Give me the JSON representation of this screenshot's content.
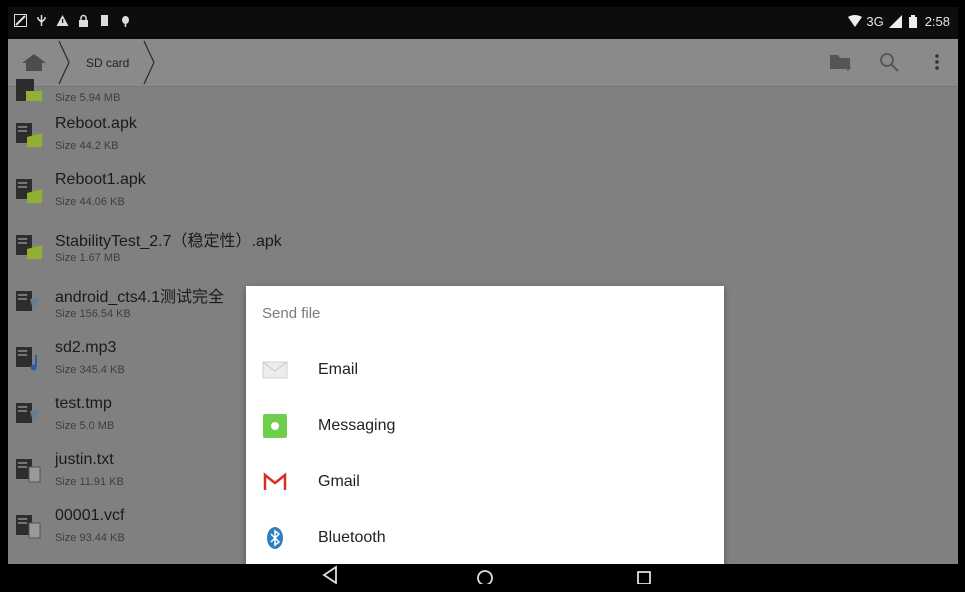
{
  "status_bar": {
    "network": "3G",
    "time": "2:58"
  },
  "action_bar": {
    "breadcrumb": "SD card",
    "icons": [
      "home-icon",
      "new-folder-icon",
      "search-icon",
      "overflow-menu-icon"
    ]
  },
  "files": [
    {
      "name": "",
      "size": "Size 5.94 MB",
      "type": "apk"
    },
    {
      "name": "Reboot.apk",
      "size": "Size 44.2 KB",
      "type": "apk"
    },
    {
      "name": "Reboot1.apk",
      "size": "Size 44.06 KB",
      "type": "apk"
    },
    {
      "name": "StabilityTest_2.7（稳定性）.apk",
      "size": "Size 1.67 MB",
      "type": "apk"
    },
    {
      "name": "android_cts4.1测试完全",
      "size": "Size 156.54 KB",
      "type": "generic"
    },
    {
      "name": "sd2.mp3",
      "size": "Size 345.4 KB",
      "type": "audio"
    },
    {
      "name": "test.tmp",
      "size": "Size 5.0 MB",
      "type": "generic"
    },
    {
      "name": "justin.txt",
      "size": "Size 11.91 KB",
      "type": "text"
    },
    {
      "name": "00001.vcf",
      "size": "Size 93.44 KB",
      "type": "text"
    }
  ],
  "dialog": {
    "title": "Send file",
    "options": [
      {
        "label": "Email",
        "icon": "email-icon"
      },
      {
        "label": "Messaging",
        "icon": "messaging-icon"
      },
      {
        "label": "Gmail",
        "icon": "gmail-icon"
      },
      {
        "label": "Bluetooth",
        "icon": "bluetooth-icon"
      }
    ]
  },
  "nav_bar": {
    "icons": [
      "back-icon",
      "home-circle-icon",
      "recents-icon"
    ]
  },
  "colors": {
    "dim_overlay": "#808080",
    "apk_green": "#9dc43a",
    "gmail_red": "#d93025",
    "bluetooth_blue": "#2d7fc1",
    "messaging_green": "#6fcf4c"
  }
}
